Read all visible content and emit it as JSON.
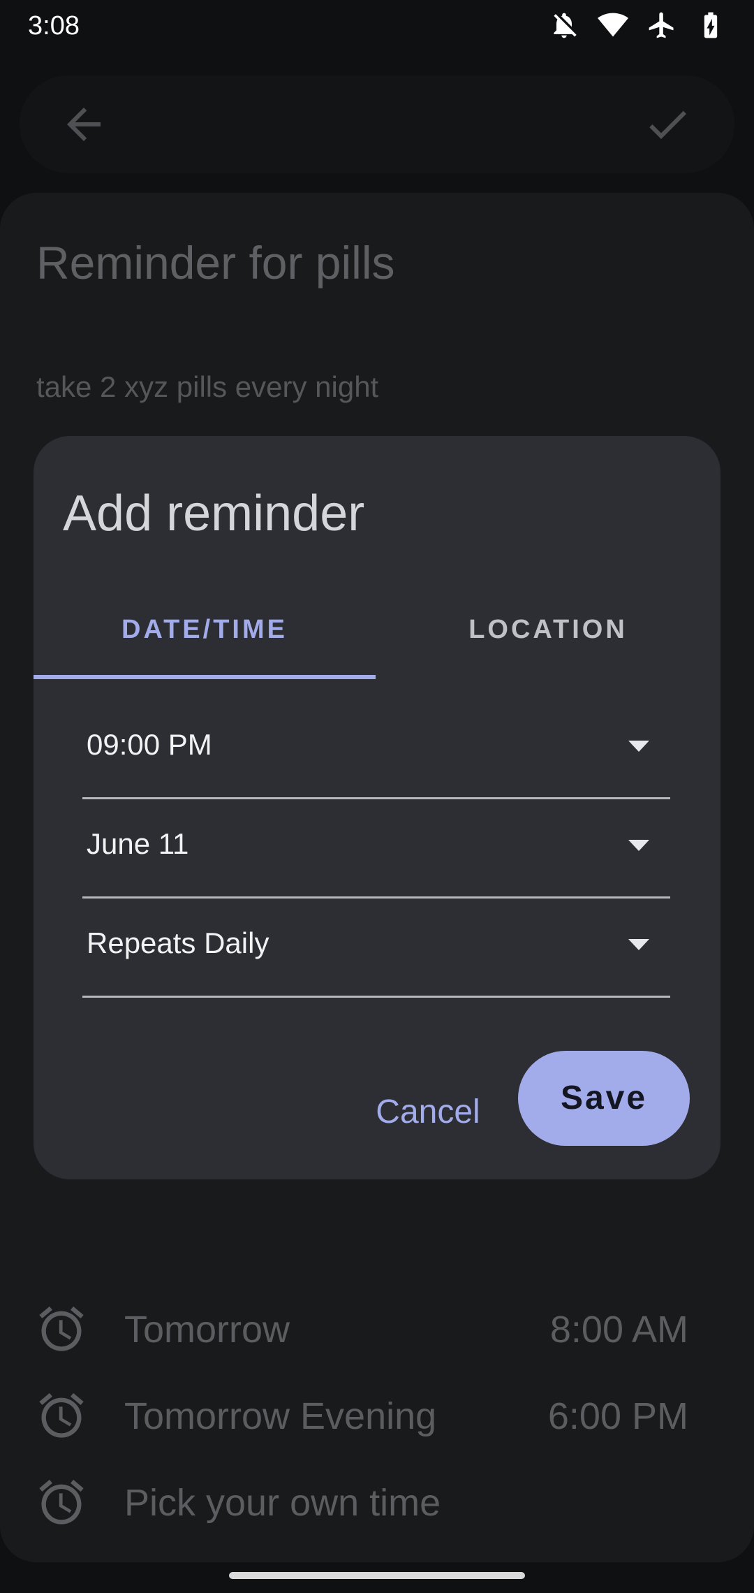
{
  "status_bar": {
    "time": "3:08",
    "icons": [
      "notifications-off-icon",
      "wifi-icon",
      "airplane-icon",
      "battery-charging-icon"
    ]
  },
  "app_bar": {
    "back_icon": "arrow-back-icon",
    "confirm_icon": "check-icon"
  },
  "note": {
    "title": "Reminder for pills",
    "body": "take 2 xyz pills every night"
  },
  "dialog": {
    "title": "Add reminder",
    "tabs": [
      {
        "label": "DATE/TIME",
        "selected": true
      },
      {
        "label": "LOCATION",
        "selected": false
      }
    ],
    "fields": {
      "time": "09:00 PM",
      "date": "June 11",
      "repeat": "Repeats Daily"
    },
    "cancel_label": "Cancel",
    "save_label": "Save"
  },
  "suggestions": [
    {
      "label": "Tomorrow",
      "time": "8:00 AM"
    },
    {
      "label": "Tomorrow Evening",
      "time": "6:00 PM"
    },
    {
      "label": "Pick your own time",
      "time": ""
    }
  ],
  "colors": {
    "accent": "#a3acea",
    "dialog_bg": "#2d2e33",
    "screen_bg": "#0f1012"
  }
}
